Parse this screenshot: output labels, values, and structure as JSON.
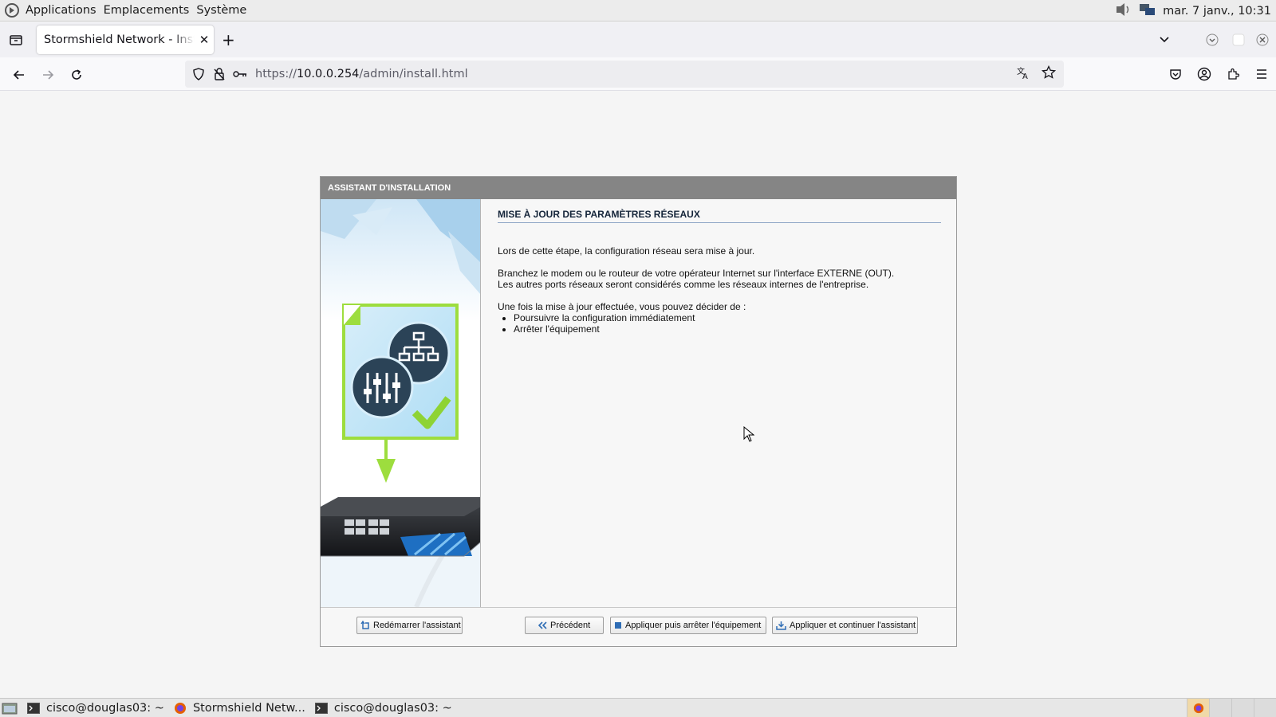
{
  "top_panel": {
    "menus": [
      "Applications",
      "Emplacements",
      "Système"
    ],
    "clock": "mar. 7 janv., 10:31"
  },
  "browser": {
    "tab_title": "Stormshield Network - Installation",
    "url_scheme": "https://",
    "url_host": "10.0.0.254",
    "url_path": "/admin/install.html"
  },
  "wizard": {
    "header": "ASSISTANT D'INSTALLATION",
    "title": "MISE À JOUR DES PARAMÈTRES RÉSEAUX",
    "para1": "Lors de cette étape, la configuration réseau sera mise à jour.",
    "para2_line1": "Branchez le modem ou le routeur de votre opérateur Internet sur l'interface EXTERNE (OUT).",
    "para2_line2": "Les autres ports réseaux seront considérés comme les réseaux internes de l'entreprise.",
    "para3": "Une fois la mise à jour effectuée, vous pouvez décider de :",
    "options": [
      "Poursuivre la configuration immédiatement",
      "Arrêter l'équipement"
    ],
    "buttons": {
      "restart": "Redémarrer l'assistant",
      "previous": "Précédent",
      "apply_stop": "Appliquer puis arrêter l'équipement",
      "apply_continue": "Appliquer et continuer l'assistant"
    }
  },
  "taskbar": {
    "items": [
      "cisco@douglas03: ~",
      "Stormshield Netw...",
      "cisco@douglas03: ~"
    ]
  },
  "colors": {
    "wizard_header": "#858585",
    "accent_green": "#8ed334",
    "icon_dark": "#2b4357"
  }
}
